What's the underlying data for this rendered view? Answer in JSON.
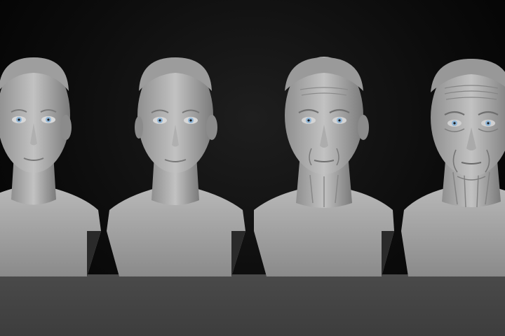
{
  "scene": {
    "description_visible_text": "",
    "busts": [
      {
        "id": "bust-1",
        "age_stage": 1
      },
      {
        "id": "bust-2",
        "age_stage": 2
      },
      {
        "id": "bust-3",
        "age_stage": 3
      },
      {
        "id": "bust-4",
        "age_stage": 4
      }
    ],
    "colors": {
      "background": "#000000",
      "floor": "#404040",
      "clay": "#a9a9a9",
      "iris": "#8fb6d8"
    }
  }
}
